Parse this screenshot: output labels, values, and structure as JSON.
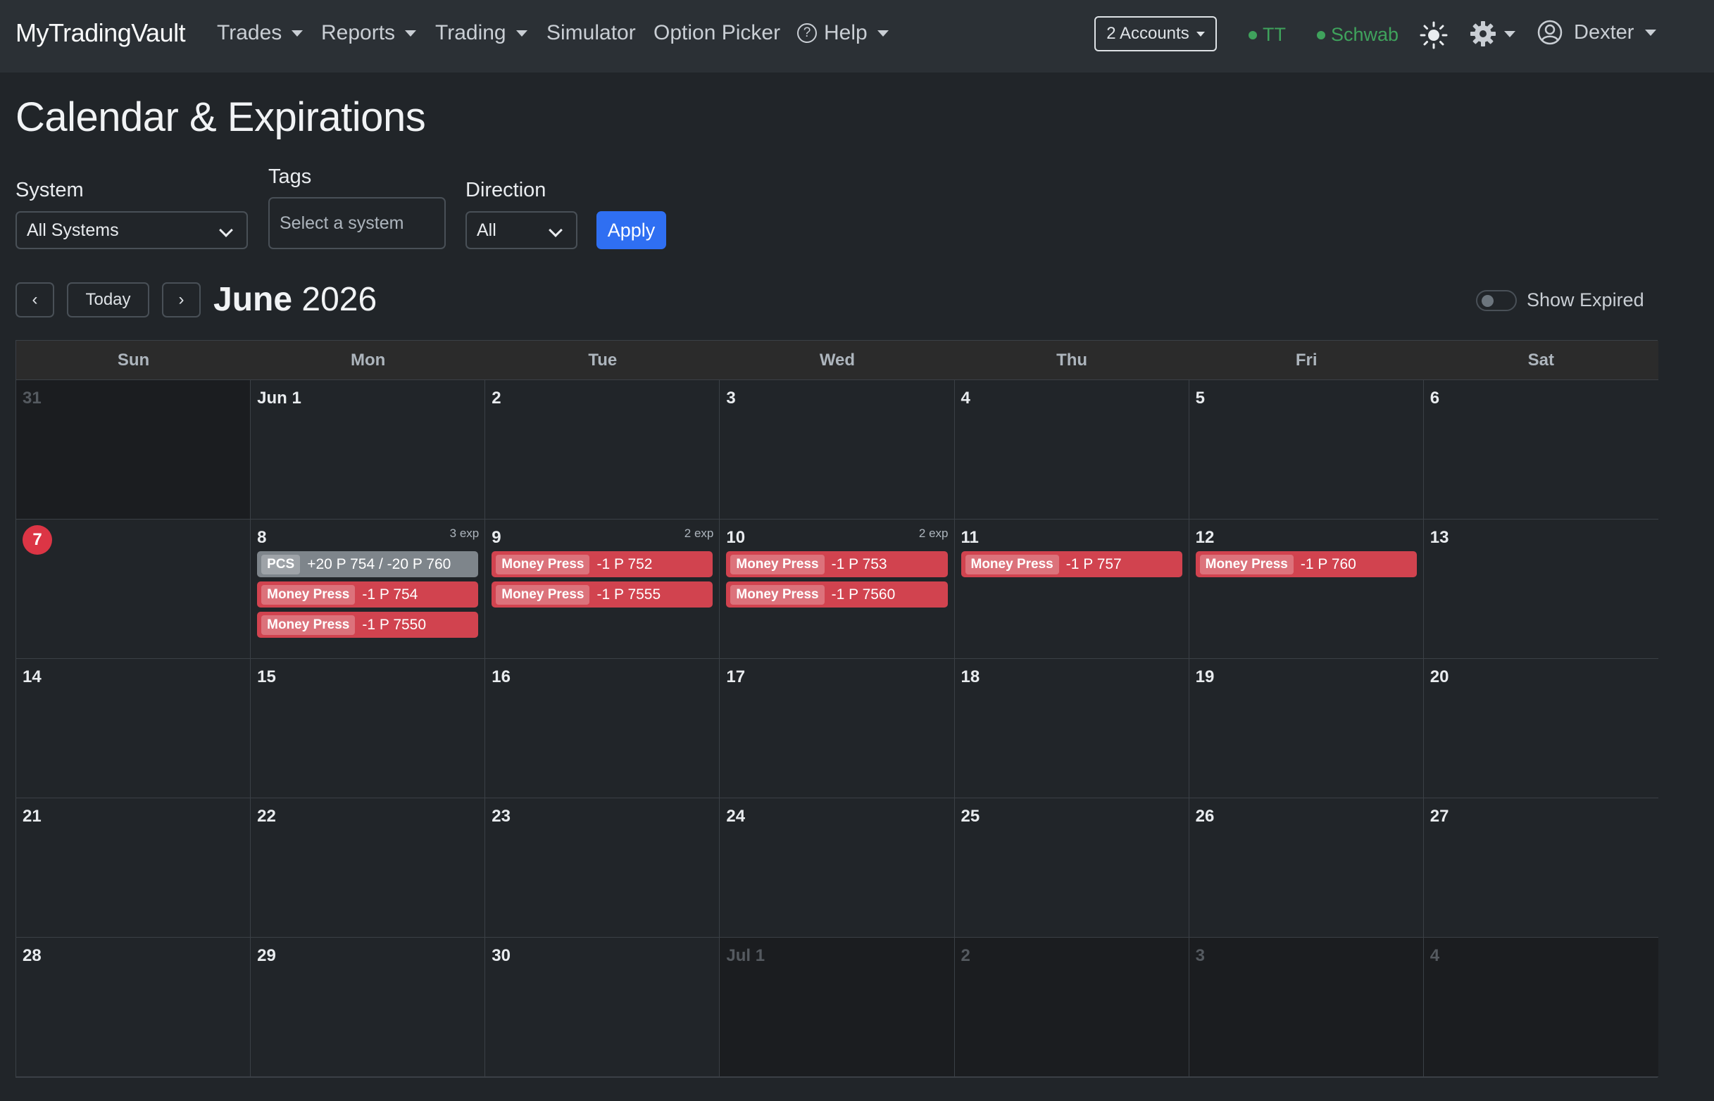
{
  "navbar": {
    "brand": "MyTradingVault",
    "items": [
      {
        "label": "Trades",
        "dropdown": true
      },
      {
        "label": "Reports",
        "dropdown": true
      },
      {
        "label": "Trading",
        "dropdown": true
      },
      {
        "label": "Simulator",
        "dropdown": false
      },
      {
        "label": "Option Picker",
        "dropdown": false
      },
      {
        "label": "Help",
        "dropdown": true
      }
    ],
    "help_icon_text": "?",
    "accounts_label": "2 Accounts",
    "status_tt": "TT",
    "status_schwab": "Schwab",
    "status_color": "#3fa25c",
    "user_name": "Dexter"
  },
  "page": {
    "title": "Calendar & Expirations"
  },
  "filters": {
    "system_label": "System",
    "system_value": "All Systems",
    "tags_label": "Tags",
    "tags_placeholder": "Select a system",
    "direction_label": "Direction",
    "direction_value": "All",
    "apply_label": "Apply"
  },
  "calendar_nav": {
    "prev": "‹",
    "today": "Today",
    "next": "›",
    "month": "June",
    "year": "2026",
    "show_expired_label": "Show Expired",
    "show_expired_on": false
  },
  "calendar": {
    "weekdays": [
      "Sun",
      "Mon",
      "Tue",
      "Wed",
      "Thu",
      "Fri",
      "Sat"
    ],
    "days": [
      {
        "label": "31",
        "other": true
      },
      {
        "label": "Jun 1"
      },
      {
        "label": "2"
      },
      {
        "label": "3"
      },
      {
        "label": "4"
      },
      {
        "label": "5"
      },
      {
        "label": "6"
      },
      {
        "label": "7",
        "today": true
      },
      {
        "label": "8",
        "count": "3 exp",
        "events": [
          {
            "tag": "PCS",
            "desc": "+20 P 754 / -20 P 760",
            "kind": "pcs"
          },
          {
            "tag": "Money Press",
            "desc": "-1 P 754",
            "kind": "short"
          },
          {
            "tag": "Money Press",
            "desc": "-1 P 7550",
            "kind": "short"
          }
        ]
      },
      {
        "label": "9",
        "count": "2 exp",
        "events": [
          {
            "tag": "Money Press",
            "desc": "-1 P 752",
            "kind": "short"
          },
          {
            "tag": "Money Press",
            "desc": "-1 P 7555",
            "kind": "short"
          }
        ]
      },
      {
        "label": "10",
        "count": "2 exp",
        "events": [
          {
            "tag": "Money Press",
            "desc": "-1 P 753",
            "kind": "short"
          },
          {
            "tag": "Money Press",
            "desc": "-1 P 7560",
            "kind": "short"
          }
        ]
      },
      {
        "label": "11",
        "events": [
          {
            "tag": "Money Press",
            "desc": "-1 P 757",
            "kind": "short"
          }
        ]
      },
      {
        "label": "12",
        "events": [
          {
            "tag": "Money Press",
            "desc": "-1 P 760",
            "kind": "short"
          }
        ]
      },
      {
        "label": "13"
      },
      {
        "label": "14"
      },
      {
        "label": "15"
      },
      {
        "label": "16"
      },
      {
        "label": "17"
      },
      {
        "label": "18"
      },
      {
        "label": "19"
      },
      {
        "label": "20"
      },
      {
        "label": "21"
      },
      {
        "label": "22"
      },
      {
        "label": "23"
      },
      {
        "label": "24"
      },
      {
        "label": "25"
      },
      {
        "label": "26"
      },
      {
        "label": "27"
      },
      {
        "label": "28"
      },
      {
        "label": "29"
      },
      {
        "label": "30"
      },
      {
        "label": "Jul 1",
        "other": true
      },
      {
        "label": "2",
        "other": true
      },
      {
        "label": "3",
        "other": true
      },
      {
        "label": "4",
        "other": true
      }
    ]
  },
  "colors": {
    "short_event": "#d1434f",
    "pcs_event": "#7e858b",
    "today_badge": "#dc3545",
    "apply_button": "#2f6ff2"
  },
  "icons": {
    "theme": "sun-icon",
    "settings": "gear-icon",
    "user": "user-circle-icon"
  }
}
